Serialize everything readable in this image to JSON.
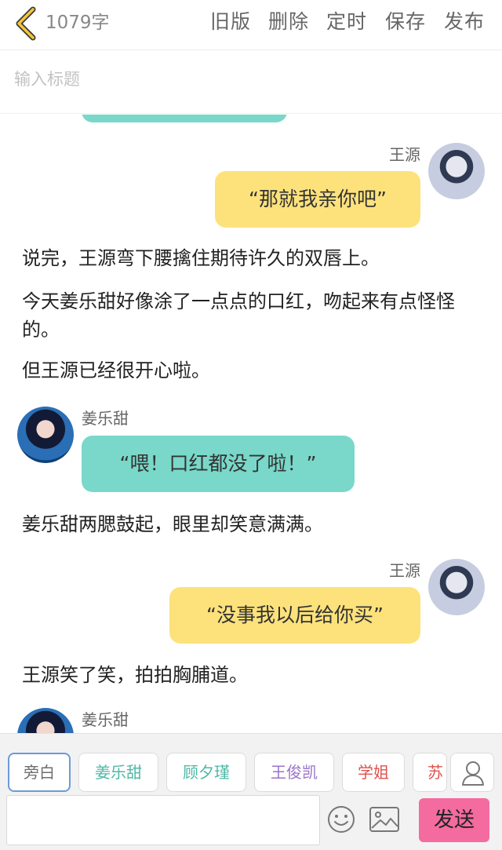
{
  "header": {
    "word_count": "1079字",
    "actions": [
      "旧版",
      "删除",
      "定时",
      "保存",
      "发布"
    ]
  },
  "title_input": {
    "placeholder": "输入标题",
    "value": ""
  },
  "messages": [
    {
      "speaker": "王源",
      "side": "right",
      "text": "“那就我亲你吧”"
    },
    {
      "narration": "说完，王源弯下腰擒住期待许久的双唇上。"
    },
    {
      "narration": "今天姜乐甜好像涂了一点点的口红，吻起来有点怪怪的。"
    },
    {
      "narration": "但王源已经很开心啦。"
    },
    {
      "speaker": "姜乐甜",
      "side": "left",
      "text": "“喂！口红都没了啦！”"
    },
    {
      "narration": "姜乐甜两腮鼓起，眼里却笑意满满。"
    },
    {
      "speaker": "王源",
      "side": "right",
      "text": "“没事我以后给你买”"
    },
    {
      "narration": "王源笑了笑，拍拍胸脯道。"
    },
    {
      "speaker": "姜乐甜",
      "side": "left",
      "text": ""
    }
  ],
  "toolbar": {
    "roles": [
      {
        "label": "旁白",
        "color": "#6e6e6e"
      },
      {
        "label": "姜乐甜",
        "color": "#4fb8a6"
      },
      {
        "label": "顾夕瑾",
        "color": "#4fb8a6"
      },
      {
        "label": "王俊凯",
        "color": "#9a73c9"
      },
      {
        "label": "学姐",
        "color": "#e0504c"
      },
      {
        "label": "苏",
        "color": "#e0504c"
      }
    ],
    "message_input": {
      "placeholder": "",
      "value": ""
    },
    "send_label": "发送"
  },
  "icons": {
    "back": "chevron-left-icon",
    "role_manage": "user-icon",
    "emoji": "smiley-icon",
    "image": "image-icon"
  },
  "colors": {
    "accent_back": "#f3c63c",
    "bubble_right": "#fde27c",
    "bubble_left": "#79d8c9",
    "send_button": "#f46ba0"
  }
}
